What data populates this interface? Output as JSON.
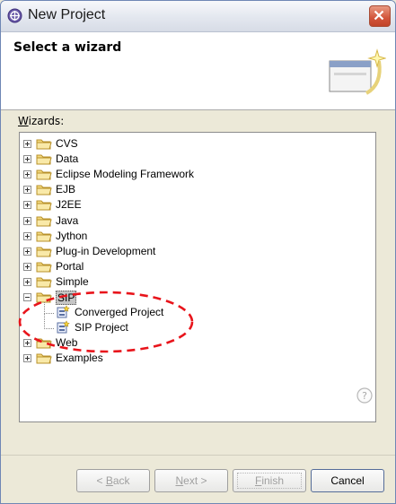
{
  "window": {
    "title": "New Project"
  },
  "header": {
    "title": "Select a wizard"
  },
  "wizards": {
    "label_prefix": "W",
    "label_rest": "izards:"
  },
  "tree": {
    "items": [
      {
        "label": "CVS"
      },
      {
        "label": "Data"
      },
      {
        "label": "Eclipse Modeling Framework"
      },
      {
        "label": "EJB"
      },
      {
        "label": "J2EE"
      },
      {
        "label": "Java"
      },
      {
        "label": "Jython"
      },
      {
        "label": "Plug-in Development"
      },
      {
        "label": "Portal"
      },
      {
        "label": "Simple"
      },
      {
        "label": "SIP",
        "expanded": true,
        "selected": true,
        "children": [
          {
            "label": "Converged Project"
          },
          {
            "label": "SIP Project"
          }
        ]
      },
      {
        "label": "Web"
      },
      {
        "label": "Examples"
      }
    ]
  },
  "buttons": {
    "back": {
      "prefix": "< ",
      "mnemonic": "B",
      "rest": "ack"
    },
    "next": {
      "mnemonic": "N",
      "rest": "ext >"
    },
    "finish": {
      "mnemonic": "F",
      "rest": "inish"
    },
    "cancel": "Cancel"
  },
  "icons": {
    "app": "eclipse-new-project-icon",
    "close": "close-icon",
    "folder": "folder-icon",
    "project": "sip-project-icon",
    "help": "help-icon"
  },
  "colors": {
    "annotation": "#e8141b",
    "folder": "#f3d97e",
    "selection": "#c5c5c5"
  }
}
